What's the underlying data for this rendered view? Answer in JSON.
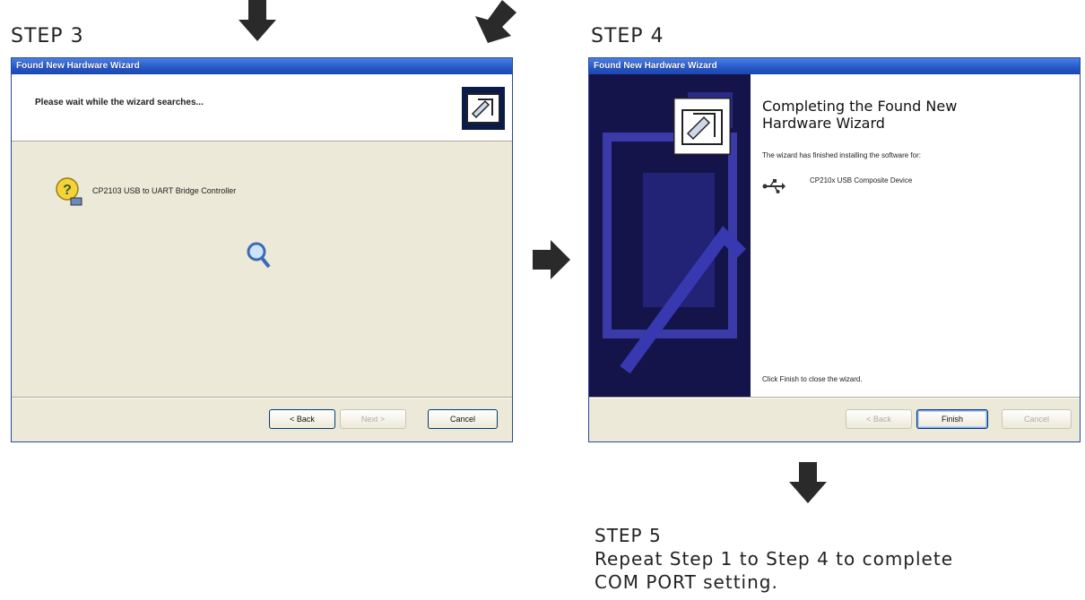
{
  "step3": {
    "label": "STEP 3",
    "window": {
      "title": "Found New Hardware Wizard",
      "header_text": "Please wait while the wizard searches...",
      "device_name": "CP2103 USB to UART Bridge Controller",
      "buttons": {
        "back": "< Back",
        "next": "Next >",
        "cancel": "Cancel"
      }
    }
  },
  "step4": {
    "label": "STEP 4",
    "window": {
      "title": "Found New Hardware Wizard",
      "heading": "Completing the Found New Hardware Wizard",
      "body_text": "The wizard has finished installing the software for:",
      "device_name": "CP210x USB Composite Device",
      "finish_text": "Click Finish to close the wizard.",
      "buttons": {
        "back": "< Back",
        "finish": "Finish",
        "cancel": "Cancel"
      }
    }
  },
  "step5": {
    "label": "STEP 5",
    "line1": "Repeat Step 1 to Step 4 to complete",
    "line2": "COM PORT setting."
  },
  "colors": {
    "titlebar": "#2457c5",
    "dialog_bg": "#ece9d8",
    "sidebar": "#1a1a5a",
    "arrow": "#2a2a2a"
  },
  "icons": [
    "arrow-down-icon",
    "arrow-diagonal-icon",
    "arrow-right-icon",
    "hardware-wizard-icon",
    "question-device-icon",
    "searching-icon",
    "usb-icon"
  ]
}
